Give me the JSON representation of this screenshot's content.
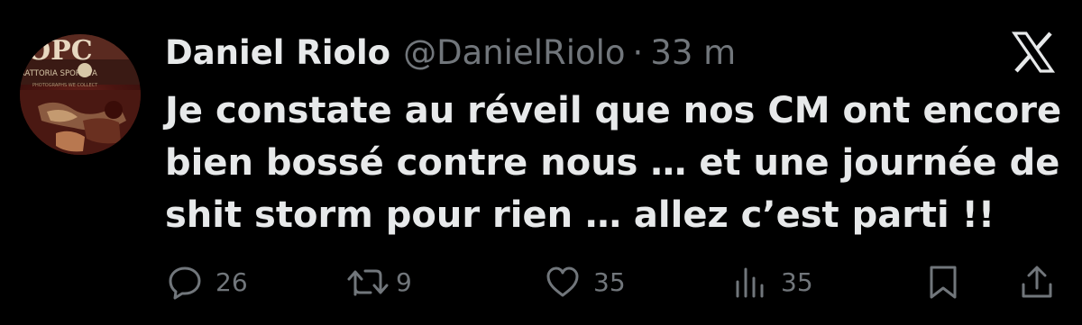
{
  "tweet": {
    "display_name": "Daniel Riolo",
    "handle": "@DanielRiolo",
    "separator": "·",
    "time": "33 m",
    "text_lines": [
      "Je constate au réveil que nos CM ont encore",
      "bien bossé contre nous … et une journée de",
      "shit storm pour rien … allez c’est parti !!"
    ],
    "avatar": {
      "logo_text": "OPC",
      "sign_text": "RATTORIA SPORTIVA",
      "small_text": "PHOTOGRAPHS WE COLLECT"
    }
  },
  "actions": {
    "reply_count": "26",
    "retweet_count": "9",
    "like_count": "35",
    "views_count": "35"
  },
  "icons": {
    "reply": "reply-icon",
    "retweet": "retweet-icon",
    "like": "heart-icon",
    "views": "views-icon",
    "bookmark": "bookmark-icon",
    "share": "share-icon",
    "brand": "x-logo-icon"
  },
  "colors": {
    "background": "#000000",
    "text": "#e7e9ea",
    "secondary": "#71767b"
  }
}
